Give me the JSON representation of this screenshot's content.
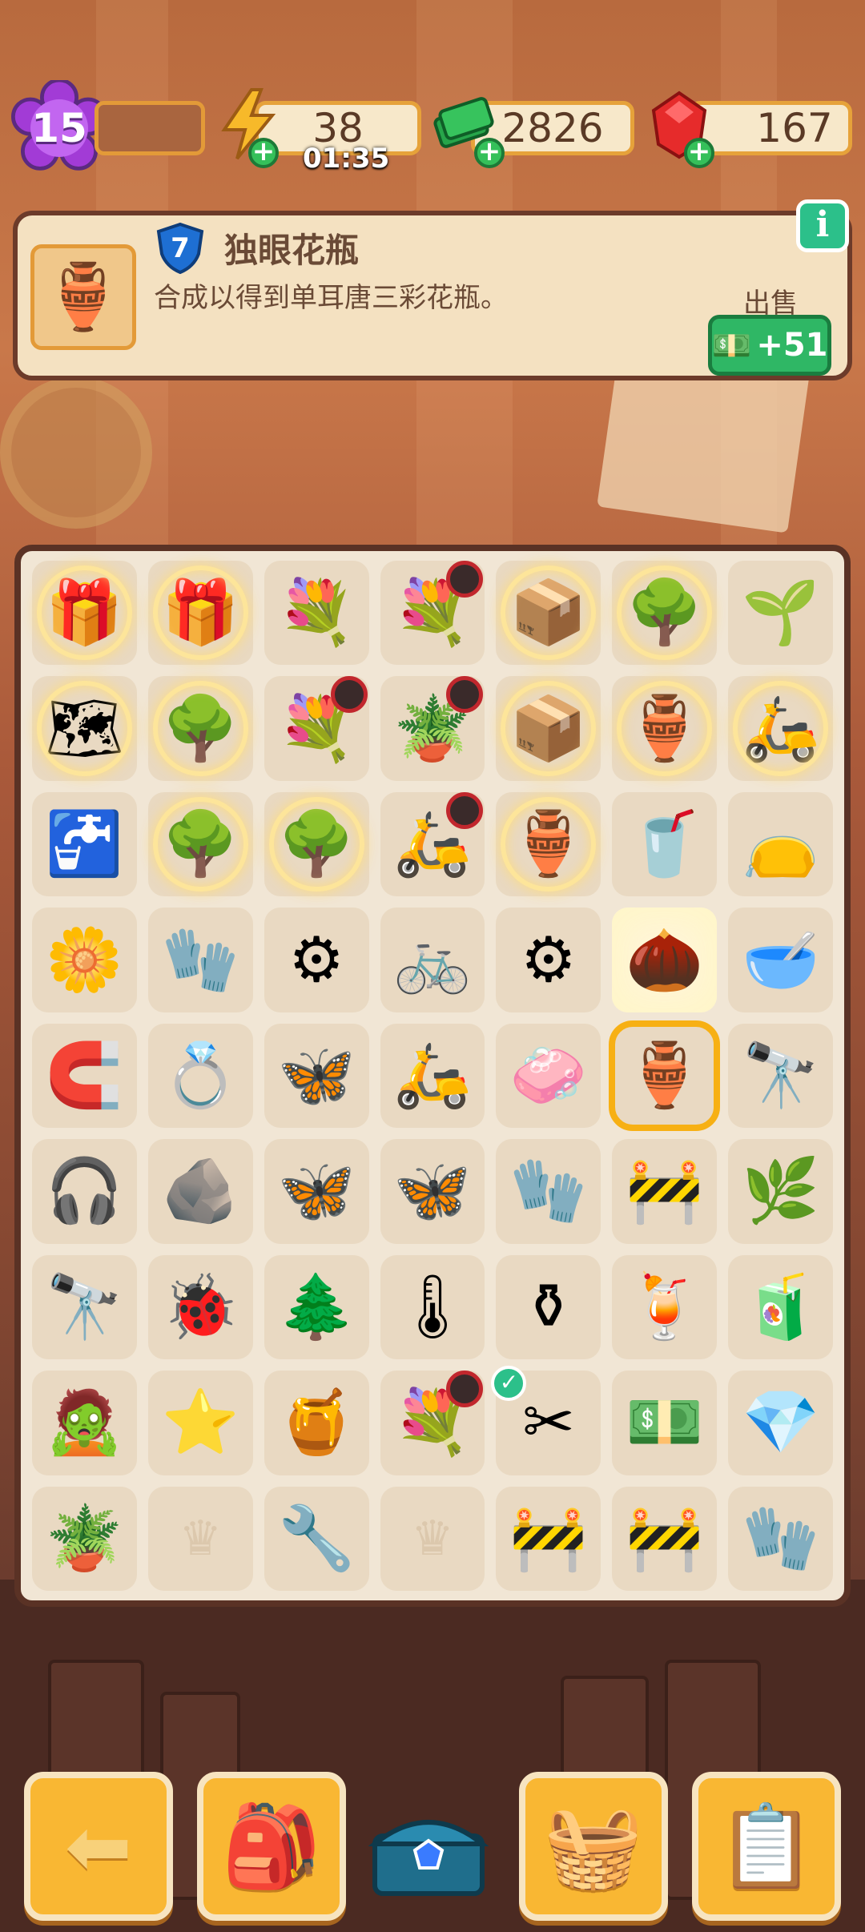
{
  "level": "15",
  "resources": {
    "energy": {
      "value": "38",
      "timer": "01:35",
      "icon": "lightning-icon"
    },
    "cash": {
      "value": "2826",
      "icon": "cash-stack-icon"
    },
    "gems": {
      "value": "167",
      "icon": "ruby-icon"
    }
  },
  "selected_item": {
    "level": "7",
    "name": "独眼花瓶",
    "description": "合成以得到单耳唐三彩花瓶。",
    "sell_label": "出售",
    "sell_value": "+51",
    "icon": "vase-icon"
  },
  "board": {
    "rows": [
      [
        "gift-bubble",
        "gift-bubble",
        "flower-basket",
        "flower-basket-timer",
        "box-bubble",
        "tree-bubble",
        "sprout"
      ],
      [
        "map-bubble",
        "tree-bubble",
        "flower-basket-timer",
        "pot-plant-timer",
        "box-bubble",
        "vase-bubble",
        "scooter-bubble"
      ],
      [
        "sink",
        "tree-bubble",
        "tree-bubble",
        "scooter-timer",
        "vase-bubble",
        "cup",
        "seed-bag"
      ],
      [
        "flowers",
        "glove",
        "wheel",
        "bicycle",
        "wheels",
        "seeds",
        "bowl"
      ],
      [
        "horseshoe",
        "ring",
        "moth",
        "scooter",
        "soap",
        "vase-selected",
        "binoculars"
      ],
      [
        "headphones",
        "shard",
        "moth",
        "butterfly",
        "glove",
        "barrier",
        "herbs"
      ],
      [
        "telescope",
        "beetle",
        "bonsai",
        "thermometer",
        "vase",
        "smoothie",
        "bottle"
      ],
      [
        "mummy",
        "star",
        "honey",
        "flower-basket-timer",
        "scissors",
        "cash",
        "gem"
      ],
      [
        "plant",
        "empty",
        "pliers",
        "empty",
        "barrier",
        "barrier",
        "glove"
      ]
    ],
    "glyphs": {
      "gift-bubble": "🎁",
      "flower-basket": "💐",
      "flower-basket-timer": "💐",
      "box-bubble": "📦",
      "tree-bubble": "🌳",
      "sprout": "🌱",
      "map-bubble": "🗺",
      "pot-plant-timer": "🪴",
      "vase-bubble": "🏺",
      "scooter-bubble": "🛵",
      "sink": "🚰",
      "scooter-timer": "🛵",
      "cup": "🥤",
      "seed-bag": "👝",
      "flowers": "🌼",
      "glove": "🧤",
      "wheel": "⚙",
      "bicycle": "🚲",
      "wheels": "⚙",
      "seeds": "🌰",
      "bowl": "🥣",
      "horseshoe": "🧲",
      "ring": "💍",
      "moth": "🦋",
      "scooter": "🛵",
      "soap": "🧼",
      "vase-selected": "🏺",
      "binoculars": "🔭",
      "headphones": "🎧",
      "shard": "🪨",
      "butterfly": "🦋",
      "barrier": "🚧",
      "herbs": "🌿",
      "telescope": "🔭",
      "beetle": "🐞",
      "bonsai": "🌲",
      "thermometer": "🌡",
      "vase": "⚱",
      "smoothie": "🍹",
      "bottle": "🧃",
      "mummy": "🧟",
      "star": "⭐",
      "honey": "🍯",
      "scissors": "✂",
      "cash": "💵",
      "gem": "💎",
      "plant": "🪴",
      "pliers": "🔧",
      "empty": "♛"
    }
  },
  "nav": {
    "back": "back-arrow-icon",
    "backpack": "backpack-icon",
    "chest": "treasure-chest-icon",
    "shop": "basket-icon",
    "tasks": "clipboard-icon"
  }
}
